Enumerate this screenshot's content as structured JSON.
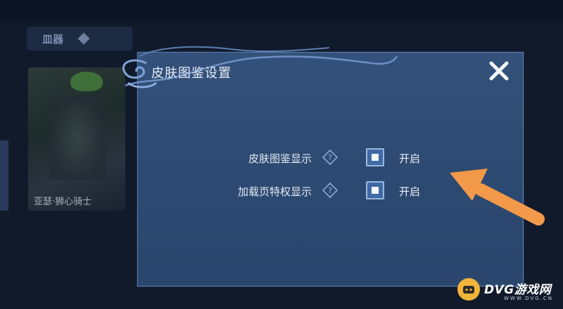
{
  "background": {
    "tab_label": "皿器",
    "card_title": "亚瑟·狮心骑士"
  },
  "dialog": {
    "title": "皮肤图鉴设置",
    "close_icon": "close-icon",
    "settings": [
      {
        "label": "皮肤图鉴显示",
        "help_icon": "question-diamond-icon",
        "checked": true,
        "state": "开启"
      },
      {
        "label": "加载页特权显示",
        "help_icon": "question-diamond-icon",
        "checked": true,
        "state": "开启"
      }
    ]
  },
  "annotation": {
    "arrow_color": "#f2994a",
    "icon": "arrow-pointer-icon"
  },
  "watermark": {
    "text": "DVG游戏网",
    "sub": "WWW.DVG.CN",
    "badge_color": "#f2b53a"
  },
  "colors": {
    "dialog_bg": "#2d4a72",
    "accent": "#3f6aa5",
    "text": "#e3eaf4"
  }
}
